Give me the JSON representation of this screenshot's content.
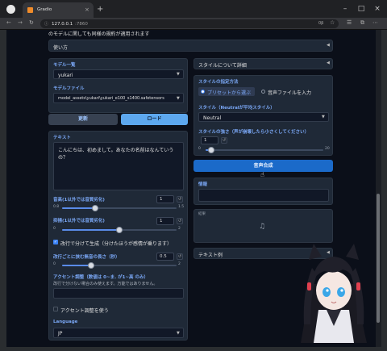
{
  "browser": {
    "tab_title": "Gradio",
    "url_host": "127.0.0.1",
    "url_port": ":7860",
    "zoom_indicator": "0β"
  },
  "top_text": "のモデルに関しても同様の規約が適用されます",
  "usage_label": "使い方",
  "model_list_label": "モデル一覧",
  "model_list_value": "yukari",
  "model_file_label": "モデルファイル",
  "model_file_value": "model_assets\\yukari\\yukari_e100_s1400.safetensors",
  "update_btn": "更新",
  "load_btn": "ロード",
  "text_label": "テキスト",
  "text_value": "こんにちは、初めまして。あなたの名前はなんていうの？",
  "sliders": [
    {
      "label": "音高(1以外では音質劣化)",
      "value": "1",
      "min": "0.8",
      "max": "1.5",
      "pos": 0.29
    },
    {
      "label": "抑揚(1以外では音質劣化)",
      "value": "1",
      "min": "0",
      "max": "2",
      "pos": 0.5
    },
    {
      "label": "改行ごとに挟む無音の長さ（秒）",
      "value": "0.5",
      "min": "0",
      "max": "2",
      "pos": 0.25
    }
  ],
  "newline_split_label": "改行で分けて生成（分けたほうが感情が乗ります）",
  "newline_split_checked": true,
  "accent_label": "アクセント調整（数値は 0~ま. が1~高 のみ）",
  "accent_hint": "改行で分けない場合のみ使えます。万能ではありません。",
  "use_accent_label": "アクセント調整を使う",
  "use_accent_checked": false,
  "language_label": "Language",
  "language_value": "JP",
  "style_detail_label": "スタイルについて詳細",
  "style_method_label": "スタイルの指定方法",
  "style_options": [
    "プリセットから選ぶ",
    "音声ファイルを入力"
  ],
  "style_selected": 0,
  "style_label": "スタイル（Neutralが平均スタイル）",
  "style_value": "Neutral",
  "style_strength_label": "スタイルの強さ（声が崩壊したら小さくしてください）",
  "style_strength_value": "1",
  "style_strength_min": "0",
  "style_strength_max": "20",
  "style_strength_pos": 0.05,
  "synth_btn": "音声合成",
  "info_label": "情報",
  "result_label": "結果",
  "music_icon": "♫",
  "text_examples_label": "テキスト例",
  "colors": {
    "primary": "#1b6ac9",
    "load": "#5da8ef",
    "accent_text": "#7aa7f5",
    "bg": "#0b0f19"
  }
}
